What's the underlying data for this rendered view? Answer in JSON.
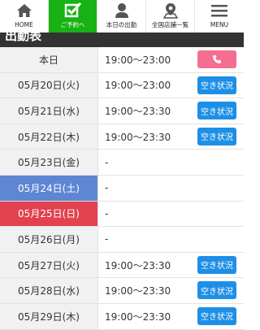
{
  "nav": {
    "home": "HOME",
    "reserve": "ご予約へ",
    "today": "本日の出勤",
    "shops": "全国店舗一覧",
    "menu": "MENU"
  },
  "section": {
    "title": "出勤表"
  },
  "schedule": {
    "status_label": "空き状況",
    "rows": [
      {
        "date": "本日",
        "time": "19:00〜23:00"
      },
      {
        "date": "05月20日(火)",
        "time": "19:00〜23:00"
      },
      {
        "date": "05月21日(水)",
        "time": "19:00〜23:30"
      },
      {
        "date": "05月22日(木)",
        "time": "19:00〜23:30"
      },
      {
        "date": "05月23日(金)",
        "time": "-"
      },
      {
        "date": "05月24日(土)",
        "time": "-"
      },
      {
        "date": "05月25日(日)",
        "time": "-"
      },
      {
        "date": "05月26日(月)",
        "time": "-"
      },
      {
        "date": "05月27日(火)",
        "time": "19:00〜23:30"
      },
      {
        "date": "05月28日(水)",
        "time": "19:00〜23:30"
      },
      {
        "date": "05月29日(木)",
        "time": "19:00〜23:30"
      }
    ]
  },
  "colors": {
    "accent_green": "#18b214",
    "saturday_blue": "#5f86d3",
    "sunday_red": "#e2424e",
    "status_button_blue": "#1e8fe6",
    "call_button_pink": "#f56d91"
  },
  "icons": [
    "home-icon",
    "check-icon",
    "person-icon",
    "map-pin-icon",
    "hamburger-menu-icon",
    "phone-icon"
  ]
}
